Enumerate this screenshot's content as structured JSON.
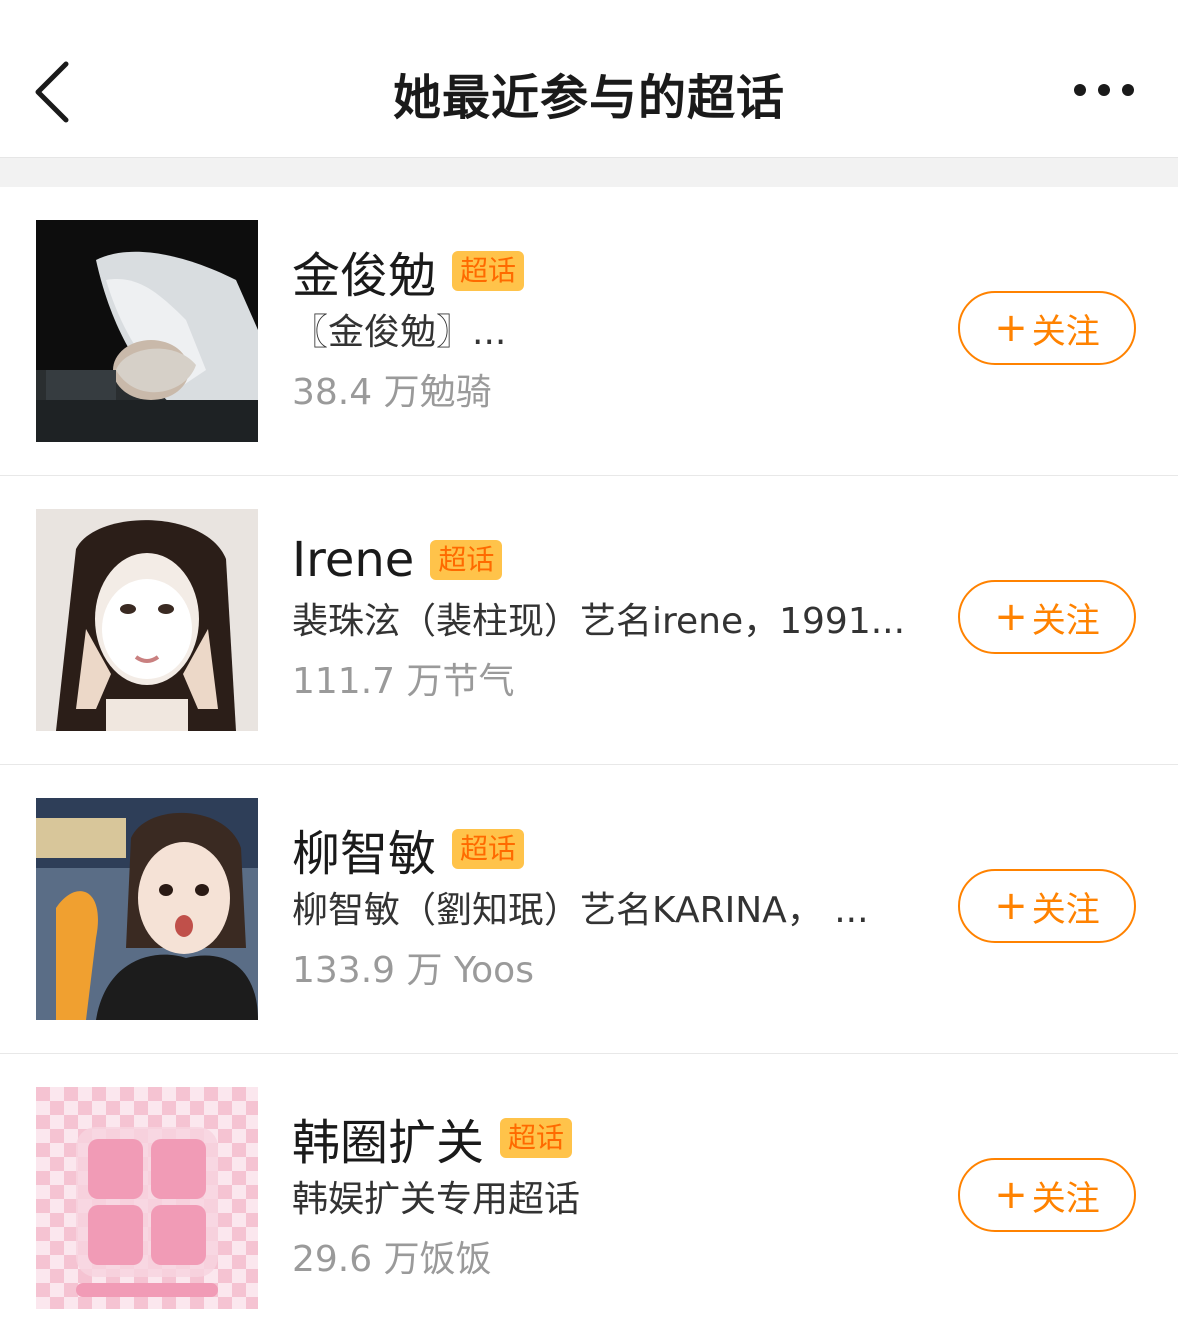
{
  "header": {
    "title": "她最近参与的超话",
    "back_icon": "chevron-left-icon",
    "more_icon": "more-dots-icon"
  },
  "colors": {
    "accent": "#ff8200",
    "badge_bg": "#ffc34a",
    "badge_text": "#ff6a00"
  },
  "topics": [
    {
      "name": "金俊勉",
      "badge": "超话",
      "description": "〖金俊勉〗...",
      "stats": "38.4 万勉骑",
      "follow_label": "关注"
    },
    {
      "name": "Irene",
      "badge": "超话",
      "description": "裴珠泫（裴柱现）艺名irene，1991...",
      "stats": "111.7 万节气",
      "follow_label": "关注"
    },
    {
      "name": "柳智敏",
      "badge": "超话",
      "description": "柳智敏（劉知珉）艺名KARINA，  ...",
      "stats": "133.9 万 Yoos",
      "follow_label": "关注"
    },
    {
      "name": "韩圈扩关",
      "badge": "超话",
      "description": "韩娱扩关专用超话",
      "stats": "29.6 万饭饭",
      "follow_label": "关注"
    }
  ]
}
